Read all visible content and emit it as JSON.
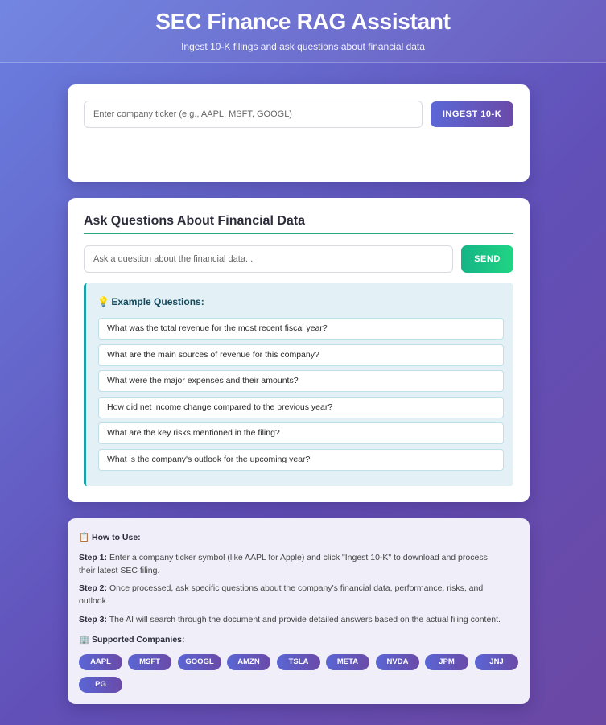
{
  "header": {
    "title": "SEC Finance RAG Assistant",
    "subtitle": "Ingest 10-K filings and ask questions about financial data"
  },
  "ingest": {
    "placeholder": "Enter company ticker (e.g., AAPL, MSFT, GOOGL)",
    "button_label": "INGEST 10-K"
  },
  "ask": {
    "title": "Ask Questions About Financial Data",
    "placeholder": "Ask a question about the financial data...",
    "send_label": "SEND",
    "examples_icon": "💡",
    "examples_title": "Example Questions:",
    "examples": [
      "What was the total revenue for the most recent fiscal year?",
      "What are the main sources of revenue for this company?",
      "What were the major expenses and their amounts?",
      "How did net income change compared to the previous year?",
      "What are the key risks mentioned in the filing?",
      "What is the company's outlook for the upcoming year?"
    ]
  },
  "help": {
    "icon": "📋",
    "title": "How to Use:",
    "steps": [
      {
        "label": "Step 1:",
        "text": "Enter a company ticker symbol (like AAPL for Apple) and click \"Ingest 10-K\" to download and process their latest SEC filing."
      },
      {
        "label": "Step 2:",
        "text": "Once processed, ask specific questions about the company's financial data, performance, risks, and outlook."
      },
      {
        "label": "Step 3:",
        "text": "The AI will search through the document and provide detailed answers based on the actual filing content."
      }
    ],
    "companies_icon": "🏢",
    "companies_title": "Supported Companies:",
    "companies": [
      "AAPL",
      "MSFT",
      "GOOGL",
      "AMZN",
      "TSLA",
      "META",
      "NVDA",
      "JPM",
      "JNJ",
      "PG"
    ]
  },
  "colors": {
    "accent": "#5b67d6",
    "send": "#1fd583",
    "examples_border": "#1aa0a8"
  }
}
